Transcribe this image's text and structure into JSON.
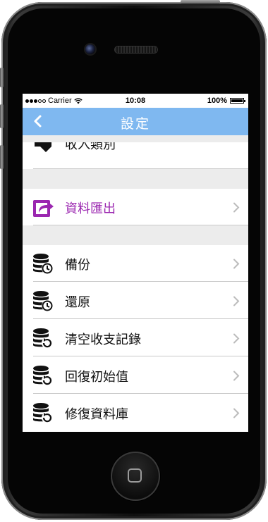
{
  "status_bar": {
    "carrier": "Carrier",
    "time": "10:08",
    "battery": "100%"
  },
  "nav": {
    "title": "設定",
    "back_icon": "chevron-left-icon"
  },
  "sections": {
    "partial_item_label": "收入類別",
    "export": {
      "label": "資料匯出",
      "icon": "export-share-icon",
      "color": "#9b27b0"
    },
    "data_items": [
      {
        "label": "備份",
        "icon": "database-clock-icon"
      },
      {
        "label": "還原",
        "icon": "database-clock-icon"
      },
      {
        "label": "清空收支記錄",
        "icon": "database-refresh-icon"
      },
      {
        "label": "回復初始值",
        "icon": "database-refresh-icon"
      },
      {
        "label": "修復資料庫",
        "icon": "database-refresh-icon"
      }
    ]
  },
  "colors": {
    "nav_bar": "#7fb8f0",
    "section_gap": "#ececec",
    "chevron": "#bcbcbc"
  }
}
